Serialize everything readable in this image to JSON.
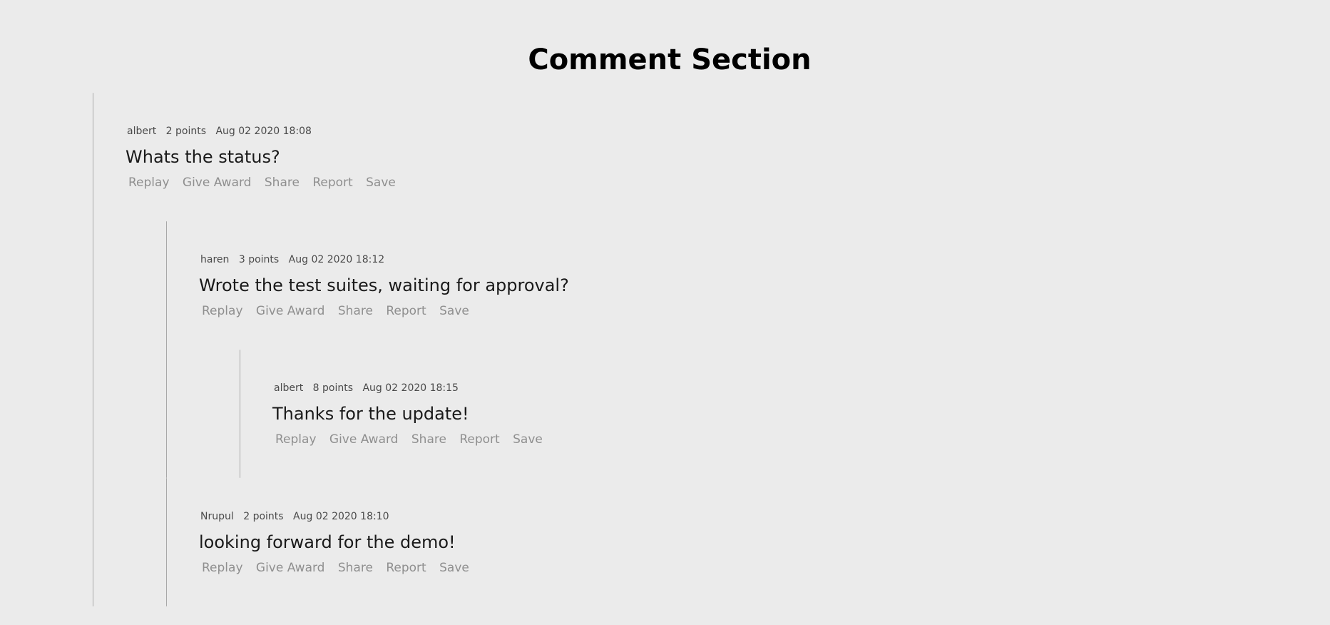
{
  "page": {
    "title": "Comment Section"
  },
  "action_labels": {
    "replay": "Replay",
    "give_award": "Give Award",
    "share": "Share",
    "report": "Report",
    "save": "Save"
  },
  "comments": [
    {
      "author": "albert",
      "points": "2 points",
      "timestamp": "Aug 02 2020 18:08",
      "text": "Whats the status?"
    },
    {
      "author": "haren",
      "points": "3 points",
      "timestamp": "Aug 02 2020 18:12",
      "text": "Wrote the test suites, waiting for approval?"
    },
    {
      "author": "albert",
      "points": "8 points",
      "timestamp": "Aug 02 2020 18:15",
      "text": "Thanks for the update!"
    },
    {
      "author": "Nrupul",
      "points": "2 points",
      "timestamp": "Aug 02 2020 18:10",
      "text": "looking forward for the demo!"
    }
  ]
}
